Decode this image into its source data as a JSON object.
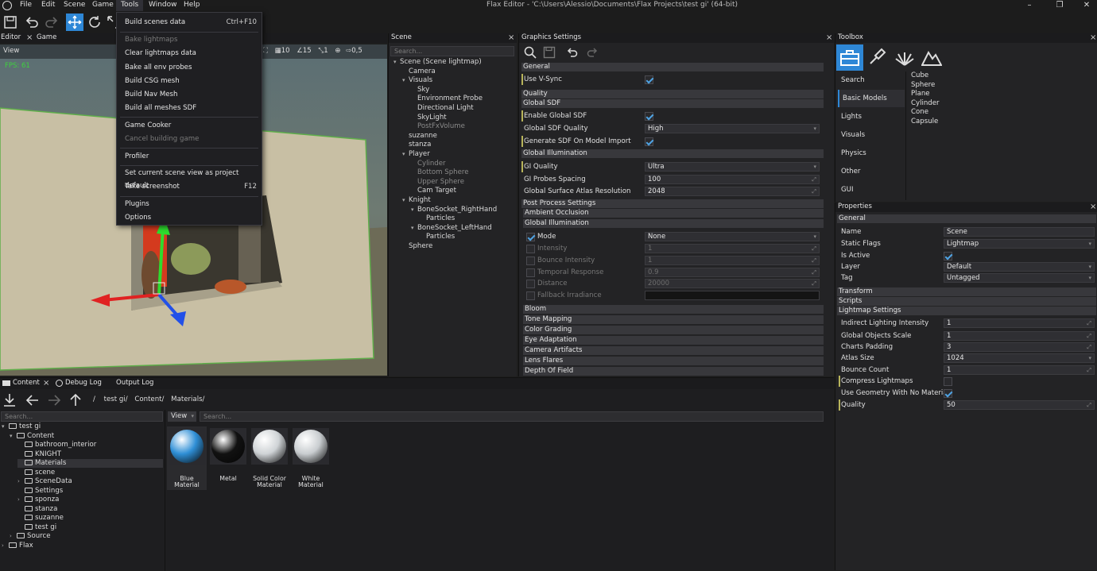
{
  "window": {
    "title": "Flax Editor - 'C:\\Users\\Alessio\\Documents\\Flax Projects\\test gi' (64-bit)",
    "menu": [
      "File",
      "Edit",
      "Scene",
      "Game",
      "Tools",
      "Window",
      "Help"
    ],
    "controls": [
      "–",
      "❐",
      "✕"
    ]
  },
  "editor_tabs": [
    "Editor",
    "Game"
  ],
  "viewport": {
    "view_label": "View",
    "fps": "FPS: 61",
    "toolbar_values": [
      "10",
      "15",
      "1",
      "0,5"
    ]
  },
  "tools_menu": {
    "items": [
      {
        "label": "Build scenes data",
        "shortcut": "Ctrl+F10",
        "enabled": true
      },
      {
        "label": "Bake lightmaps",
        "shortcut": "",
        "enabled": false
      },
      {
        "label": "Clear lightmaps data",
        "shortcut": "",
        "enabled": true
      },
      {
        "label": "Bake all env probes",
        "shortcut": "",
        "enabled": true
      },
      {
        "label": "Build CSG mesh",
        "shortcut": "",
        "enabled": true
      },
      {
        "label": "Build Nav Mesh",
        "shortcut": "",
        "enabled": true
      },
      {
        "label": "Build all meshes SDF",
        "shortcut": "",
        "enabled": true
      },
      {
        "label": "Game Cooker",
        "shortcut": "",
        "enabled": true
      },
      {
        "label": "Cancel building game",
        "shortcut": "",
        "enabled": false
      },
      {
        "label": "Profiler",
        "shortcut": "",
        "enabled": true
      },
      {
        "label": "Set current scene view as project default",
        "shortcut": "",
        "enabled": true
      },
      {
        "label": "Take screenshot",
        "shortcut": "F12",
        "enabled": true
      },
      {
        "label": "Plugins",
        "shortcut": "",
        "enabled": true
      },
      {
        "label": "Options",
        "shortcut": "",
        "enabled": true
      }
    ]
  },
  "scene_panel": {
    "title": "Scene",
    "search_placeholder": "Search...",
    "tree": [
      {
        "label": "Scene (Scene lightmap)",
        "depth": 0,
        "expander": "v",
        "dim": false
      },
      {
        "label": "Camera",
        "depth": 1,
        "expander": "",
        "dim": false
      },
      {
        "label": "Visuals",
        "depth": 1,
        "expander": "v",
        "dim": false
      },
      {
        "label": "Sky",
        "depth": 2,
        "expander": "",
        "dim": false
      },
      {
        "label": "Environment Probe",
        "depth": 2,
        "expander": "",
        "dim": false
      },
      {
        "label": "Directional Light",
        "depth": 2,
        "expander": "",
        "dim": false
      },
      {
        "label": "SkyLight",
        "depth": 2,
        "expander": "",
        "dim": false
      },
      {
        "label": "PostFxVolume",
        "depth": 2,
        "expander": "",
        "dim": true
      },
      {
        "label": "suzanne",
        "depth": 1,
        "expander": "",
        "dim": false
      },
      {
        "label": "stanza",
        "depth": 1,
        "expander": "",
        "dim": false
      },
      {
        "label": "Player",
        "depth": 1,
        "expander": "v",
        "dim": false
      },
      {
        "label": "Cylinder",
        "depth": 2,
        "expander": "",
        "dim": true
      },
      {
        "label": "Bottom Sphere",
        "depth": 2,
        "expander": "",
        "dim": true
      },
      {
        "label": "Upper Sphere",
        "depth": 2,
        "expander": "",
        "dim": true
      },
      {
        "label": "Cam Target",
        "depth": 2,
        "expander": "",
        "dim": false
      },
      {
        "label": "Knight",
        "depth": 1,
        "expander": "v",
        "dim": false
      },
      {
        "label": "BoneSocket_RightHand",
        "depth": 2,
        "expander": "v",
        "dim": false
      },
      {
        "label": "Particles",
        "depth": 3,
        "expander": "",
        "dim": false
      },
      {
        "label": "BoneSocket_LeftHand",
        "depth": 2,
        "expander": "v",
        "dim": false
      },
      {
        "label": "Particles",
        "depth": 3,
        "expander": "",
        "dim": false
      },
      {
        "label": "Sphere",
        "depth": 1,
        "expander": "",
        "dim": false
      }
    ]
  },
  "graphics_settings": {
    "title": "Graphics Settings",
    "sections": {
      "general": "General",
      "use_vsync": "Use V-Sync",
      "quality": "Quality",
      "global_sdf": "Global SDF",
      "enable_global_sdf": "Enable Global SDF",
      "global_sdf_quality": "Global SDF Quality",
      "global_sdf_quality_value": "High",
      "generate_sdf": "Generate SDF On Model Import",
      "global_illumination": "Global Illumination",
      "gi_quality": "GI Quality",
      "gi_quality_value": "Ultra",
      "gi_probes_spacing": "GI Probes Spacing",
      "gi_probes_spacing_value": "100",
      "gsa_resolution": "Global Surface Atlas Resolution",
      "gsa_resolution_value": "2048",
      "post_process": "Post Process Settings",
      "ambient_occlusion": "Ambient Occlusion",
      "pp_global_illumination": "Global Illumination",
      "mode": "Mode",
      "mode_value": "None",
      "intensity": "Intensity",
      "intensity_value": "1",
      "bounce_intensity": "Bounce Intensity",
      "bounce_intensity_value": "1",
      "temporal_response": "Temporal Response",
      "temporal_response_value": "0.9",
      "distance": "Distance",
      "distance_value": "20000",
      "fallback": "Fallback Irradiance",
      "bloom": "Bloom",
      "tone_mapping": "Tone Mapping",
      "color_grading": "Color Grading",
      "eye_adaptation": "Eye Adaptation",
      "camera_artifacts": "Camera Artifacts",
      "lens_flares": "Lens Flares",
      "depth_of_field": "Depth Of Field"
    }
  },
  "toolbox": {
    "title": "Toolbox",
    "categories": [
      "Search",
      "Basic Models",
      "Lights",
      "Visuals",
      "Physics",
      "Other",
      "GUI"
    ],
    "selected_category": "Basic Models",
    "items": [
      "Cube",
      "Sphere",
      "Plane",
      "Cylinder",
      "Cone",
      "Capsule"
    ]
  },
  "properties": {
    "title": "Properties",
    "general": "General",
    "name_label": "Name",
    "name_value": "Scene",
    "static_flags_label": "Static Flags",
    "static_flags_value": "Lightmap",
    "is_active_label": "Is Active",
    "layer_label": "Layer",
    "layer_value": "Default",
    "tag_label": "Tag",
    "tag_value": "Untagged",
    "transform": "Transform",
    "scripts": "Scripts",
    "lightmap_settings": "Lightmap Settings",
    "indirect_label": "Indirect Lighting Intensity",
    "indirect_value": "1",
    "gos_label": "Global Objects Scale",
    "gos_value": "1",
    "charts_label": "Charts Padding",
    "charts_value": "3",
    "atlas_label": "Atlas Size",
    "atlas_value": "1024",
    "bounce_label": "Bounce Count",
    "bounce_value": "1",
    "compress_label": "Compress Lightmaps",
    "usegeom_label": "Use Geometry With No Materials",
    "quality_label": "Quality",
    "quality_value": "50"
  },
  "content": {
    "tabs": [
      "Content",
      "Debug Log",
      "Output Log"
    ],
    "breadcrumb": [
      "/",
      "test gi/",
      "Content/",
      "Materials/"
    ],
    "search_placeholder": "Search...",
    "view_label": "View",
    "tree": [
      {
        "label": "test gi",
        "depth": 0,
        "expander": "v"
      },
      {
        "label": "Content",
        "depth": 1,
        "expander": "v"
      },
      {
        "label": "bathroom_interior",
        "depth": 2,
        "expander": ""
      },
      {
        "label": "KNIGHT",
        "depth": 2,
        "expander": ""
      },
      {
        "label": "Materials",
        "depth": 2,
        "expander": ""
      },
      {
        "label": "scene",
        "depth": 2,
        "expander": ""
      },
      {
        "label": "SceneData",
        "depth": 2,
        "expander": ">"
      },
      {
        "label": "Settings",
        "depth": 2,
        "expander": ""
      },
      {
        "label": "sponza",
        "depth": 2,
        "expander": ">"
      },
      {
        "label": "stanza",
        "depth": 2,
        "expander": ""
      },
      {
        "label": "suzanne",
        "depth": 2,
        "expander": ""
      },
      {
        "label": "test gi",
        "depth": 2,
        "expander": ""
      },
      {
        "label": "Source",
        "depth": 1,
        "expander": ">"
      },
      {
        "label": "Flax",
        "depth": 0,
        "expander": ">"
      }
    ],
    "assets": [
      {
        "name": "Blue Material",
        "color": "#2f8fd6"
      },
      {
        "name": "Metal",
        "color": "#111111"
      },
      {
        "name": "Solid Color Material",
        "color": "#cfd3d6"
      },
      {
        "name": "White Material",
        "color": "#c9cdd0"
      }
    ]
  },
  "colors": {
    "accent": "#2e87d6",
    "panel": "#232325",
    "header": "#38383c",
    "modified_marker": "#b8b45a"
  }
}
